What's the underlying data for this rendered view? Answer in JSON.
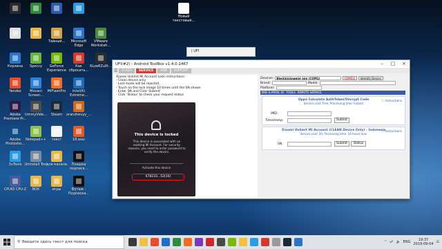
{
  "desktop": {
    "icons": [
      {
        "label": "Корзина",
        "color": "#2a75c9"
      },
      {
        "label": "Speccy",
        "color": "#6ab33c"
      },
      {
        "label": "GeForce Experience",
        "color": "#76b900"
      },
      {
        "label": "Как сбросить...",
        "color": "#d23a2e"
      },
      {
        "label": "6Loe6Zu0t...",
        "color": "#2c2c2c"
      },
      {
        "label": "Yandex",
        "color": "#e84d2a"
      },
      {
        "label": "Movavi Screen...",
        "color": "#2e7fd6"
      },
      {
        "label": "MiFlashPro",
        "color": "#f36c21"
      },
      {
        "label": "Intel(R) Extreme...",
        "color": "#1a6bb8"
      },
      {
        "label": "Adobe Premiere Pr...",
        "color": "#2e1a47"
      },
      {
        "label": "UmmyVide...",
        "color": "#4a4a4a"
      },
      {
        "label": "Steam",
        "color": "#1b2838"
      },
      {
        "label": "oranzhevyy_...",
        "color": "#cc6a1a"
      },
      {
        "label": "Adobe Photosho...",
        "color": "#0c4e8a"
      },
      {
        "label": "Notepad++",
        "color": "#8fc24a"
      },
      {
        "label": "текст",
        "color": "#f2f2f2"
      },
      {
        "label": "18.wav",
        "color": "#e05a2a"
      },
      {
        "label": "3uTools",
        "color": "#2a9de0"
      },
      {
        "label": "Uninstall Tool",
        "color": "#7a8aa0"
      },
      {
        "label": "для канала",
        "color": "#e6b84a"
      },
      {
        "label": "Плашка подписк...",
        "color": "#111111"
      },
      {
        "label": "CPUID CPU-Z",
        "color": "#4a5a9a"
      },
      {
        "label": "BOX",
        "color": "#e6b84a"
      },
      {
        "label": "игры",
        "color": "#e6b84a"
      },
      {
        "label": "Футаж - Подписка...",
        "color": "#111111"
      },
      {
        "label": "Новый текстовый...",
        "color": "#ffffff"
      }
    ],
    "top_icons": [
      {
        "label": "",
        "color": "#2a2a2a"
      },
      {
        "label": "",
        "color": "#2e8a3c"
      },
      {
        "label": "",
        "color": "#2a5db0"
      },
      {
        "label": "",
        "color": "#2a9de0"
      },
      {
        "label": "",
        "color": "#e0e0e0"
      },
      {
        "label": "",
        "color": "#e6b84a"
      },
      {
        "label": "Тайный...",
        "color": "#d2a24a"
      },
      {
        "label": "Microsoft Edge",
        "color": "#2a75c9"
      },
      {
        "label": "VMware Workstati...",
        "color": "#4a8a3a"
      }
    ],
    "ghost_text": "| UFI"
  },
  "window": {
    "title": "UFI(#2) - Android ToolBox v1.4.0.1467",
    "tabs": [
      "FLASH",
      "SERVICE",
      "ADB",
      "SUPPORT"
    ],
    "instructions": [
      "Xiaomi Unlimit Mi Account Lock instructions:",
      "- Clean device only",
      "- Lost mode will be rejected",
      "- Touch on the lock image 10 times until the SN shown",
      "- Enter SN and Click 'Submit'",
      "- Click 'Status' to check your request status"
    ],
    "phone": {
      "title": "This device is locked",
      "desc": "This device is associated with an existing Mi Account. For security reasons, you need to enter password to verify the device.",
      "activate": "Activate this device",
      "code": "678233...52(34)"
    },
    "right": {
      "devices_label": "Devices:",
      "devices_value": "Bbeåãäãäsøøãé ãõó (COM1)",
      "com": "COM11",
      "identify": "Identify Device",
      "brand_label": "Brand:",
      "model_label": "Model:",
      "platform_label": "Platform:",
      "subtabs": [
        "IMEI & PROD. ID",
        "TOOLS",
        "REMOTE SERVICE"
      ],
      "service1": {
        "title": "Oppo Calculate AuthToken/Decrypt Code",
        "sub": "Service cost: Free, Processing time: Instant",
        "instr": "Instructions",
        "imei": "IMEI:",
        "ts": "Timestamp:",
        "submit": "Submit"
      },
      "service2": {
        "title": "Xiaomi Unlimit Mi Account (CLEAN Device Only) - Indonesia",
        "sub": "Service cost: 20, Processing time: 24 hours max",
        "instr": "Instructions",
        "sn": "SN:",
        "submit": "Submit",
        "status": "Status"
      }
    }
  },
  "taskbar": {
    "search_placeholder": "Введите здесь текст для поиска",
    "lang": "ENG",
    "time": "19:37",
    "date": "2019-09-04",
    "apps": [
      "#3a3a3a",
      "#f0c040",
      "#e84d2a",
      "#1f6fc9",
      "#2e8a3c",
      "#f36c21",
      "#7a3ab8",
      "#cc2a2a",
      "#4a4a4a",
      "#76b900",
      "#f0c040",
      "#2a9de0",
      "#d23a2e",
      "#9a9a9a",
      "#1b2838",
      "#2a75c9"
    ]
  }
}
